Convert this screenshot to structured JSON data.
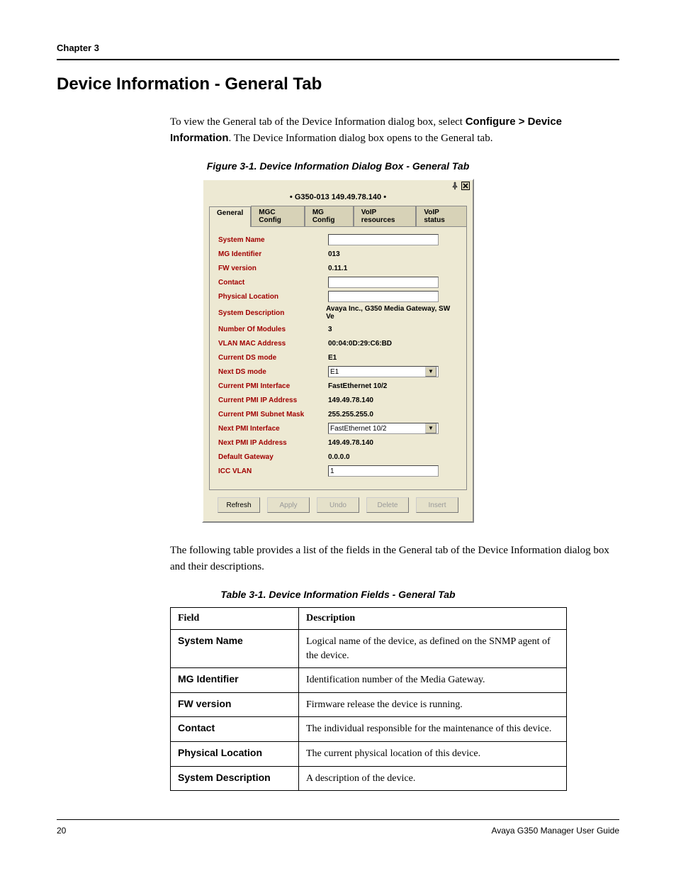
{
  "page": {
    "chapter": "Chapter 3",
    "heading": "Device Information - General Tab",
    "intro_pre": "To view the General tab of the Device Information dialog box, select ",
    "intro_bold": "Configure > Device Information",
    "intro_post": ". The Device Information dialog box opens to the General tab.",
    "figure_caption": "Figure 3-1.  Device Information Dialog Box - General Tab",
    "para2": "The following table provides a list of the fields in the General tab of the Device Information dialog box and their descriptions.",
    "table_caption": "Table 3-1.  Device Information Fields - General Tab",
    "page_number": "20",
    "footer_right": "Avaya G350 Manager User Guide"
  },
  "dialog": {
    "title": "• G350-013 149.49.78.140 •",
    "tabs": [
      "General",
      "MGC Config",
      "MG Config",
      "VoIP resources",
      "VoIP status"
    ],
    "active_tab_index": 0,
    "fields": [
      {
        "label": "System Name",
        "type": "input",
        "value": ""
      },
      {
        "label": "MG Identifier",
        "type": "text",
        "value": "013"
      },
      {
        "label": "FW version",
        "type": "text",
        "value": "0.11.1"
      },
      {
        "label": "Contact",
        "type": "input",
        "value": ""
      },
      {
        "label": "Physical Location",
        "type": "input",
        "value": ""
      },
      {
        "label": "System Description",
        "type": "text",
        "value": "Avaya Inc., G350 Media Gateway, SW Ve"
      },
      {
        "label": "Number Of Modules",
        "type": "text",
        "value": "3"
      },
      {
        "label": "VLAN MAC Address",
        "type": "text",
        "value": "00:04:0D:29:C6:BD"
      },
      {
        "label": "Current DS mode",
        "type": "text",
        "value": "E1"
      },
      {
        "label": "Next DS mode",
        "type": "select",
        "value": "E1"
      },
      {
        "label": "Current PMI Interface",
        "type": "text",
        "value": "FastEthernet 10/2"
      },
      {
        "label": "Current PMI IP Address",
        "type": "text",
        "value": "149.49.78.140"
      },
      {
        "label": "Current PMI Subnet Mask",
        "type": "text",
        "value": "255.255.255.0"
      },
      {
        "label": "Next PMI Interface",
        "type": "select",
        "value": "FastEthernet 10/2"
      },
      {
        "label": "Next PMI IP Address",
        "type": "text",
        "value": "149.49.78.140"
      },
      {
        "label": "Default Gateway",
        "type": "text",
        "value": "0.0.0.0"
      },
      {
        "label": "ICC VLAN",
        "type": "input",
        "value": "1"
      }
    ],
    "buttons": [
      {
        "label": "Refresh",
        "enabled": true
      },
      {
        "label": "Apply",
        "enabled": false
      },
      {
        "label": "Undo",
        "enabled": false
      },
      {
        "label": "Delete",
        "enabled": false
      },
      {
        "label": "Insert",
        "enabled": false
      }
    ]
  },
  "fields_table": {
    "header_field": "Field",
    "header_desc": "Description",
    "rows": [
      {
        "field": "System Name",
        "desc": "Logical name of the device, as defined on the SNMP agent of the device."
      },
      {
        "field": "MG Identifier",
        "desc": "Identification number of the Media Gateway."
      },
      {
        "field": "FW version",
        "desc": "Firmware release the device is running."
      },
      {
        "field": "Contact",
        "desc": "The individual responsible for the maintenance of this device."
      },
      {
        "field": "Physical Location",
        "desc": "The current physical location of this device."
      },
      {
        "field": "System Description",
        "desc": "A description of the device."
      }
    ]
  }
}
